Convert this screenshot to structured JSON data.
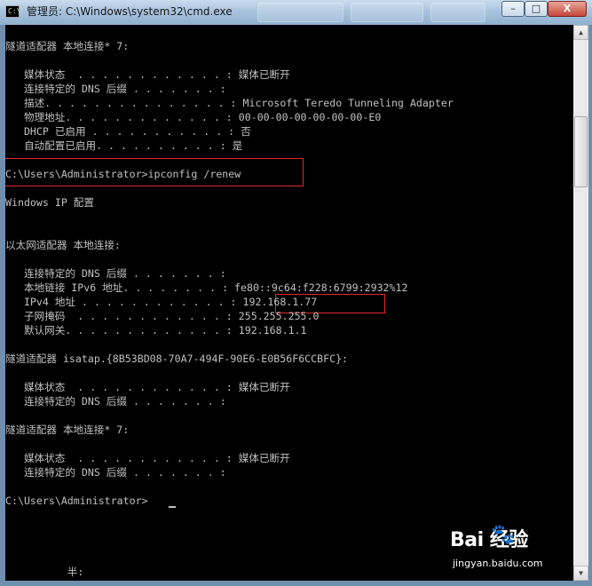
{
  "window": {
    "title": "管理员: C:\\Windows\\system32\\cmd.exe",
    "app_icon_text": "C:\\",
    "controls": {
      "minimize": "–",
      "maximize": "□",
      "close": "X"
    }
  },
  "console": {
    "lines": [
      "隧道适配器 本地连接* 7:",
      "",
      "   媒体状态  . . . . . . . . . . . . : 媒体已断开",
      "   连接特定的 DNS 后缀 . . . . . . . :",
      "   描述. . . . . . . . . . . . . . . : Microsoft Teredo Tunneling Adapter",
      "   物理地址. . . . . . . . . . . . . : 00-00-00-00-00-00-00-E0",
      "   DHCP 已启用 . . . . . . . . . . . : 否",
      "   自动配置已启用. . . . . . . . . . : 是",
      "",
      "C:\\Users\\Administrator>ipconfig /renew",
      "",
      "Windows IP 配置",
      "",
      "",
      "以太网适配器 本地连接:",
      "",
      "   连接特定的 DNS 后缀 . . . . . . . :",
      "   本地链接 IPv6 地址. . . . . . . . : fe80::9c64:f228:6799:2932%12",
      "   IPv4 地址 . . . . . . . . . . . . : 192.168.1.77",
      "   子网掩码  . . . . . . . . . . . . : 255.255.255.0",
      "   默认网关. . . . . . . . . . . . . : 192.168.1.1",
      "",
      "隧道适配器 isatap.{8B53BD08-70A7-494F-90E6-E0B56F6CCBFC}:",
      "",
      "   媒体状态  . . . . . . . . . . . . : 媒体已断开",
      "   连接特定的 DNS 后缀 . . . . . . . :",
      "",
      "隧道适配器 本地连接* 7:",
      "",
      "   媒体状态  . . . . . . . . . . . . : 媒体已断开",
      "   连接特定的 DNS 后缀 . . . . . . . :",
      "",
      "C:\\Users\\Administrator>",
      "",
      "",
      "",
      "",
      "          半:"
    ]
  },
  "watermark": {
    "logo": "Bai  经验",
    "subtitle": "jingyan.baidu.com"
  },
  "colors": {
    "console_bg": "#000000",
    "console_text": "#c0c0c0",
    "highlight": "#e0282c",
    "titlebar": "#a8c3de"
  }
}
